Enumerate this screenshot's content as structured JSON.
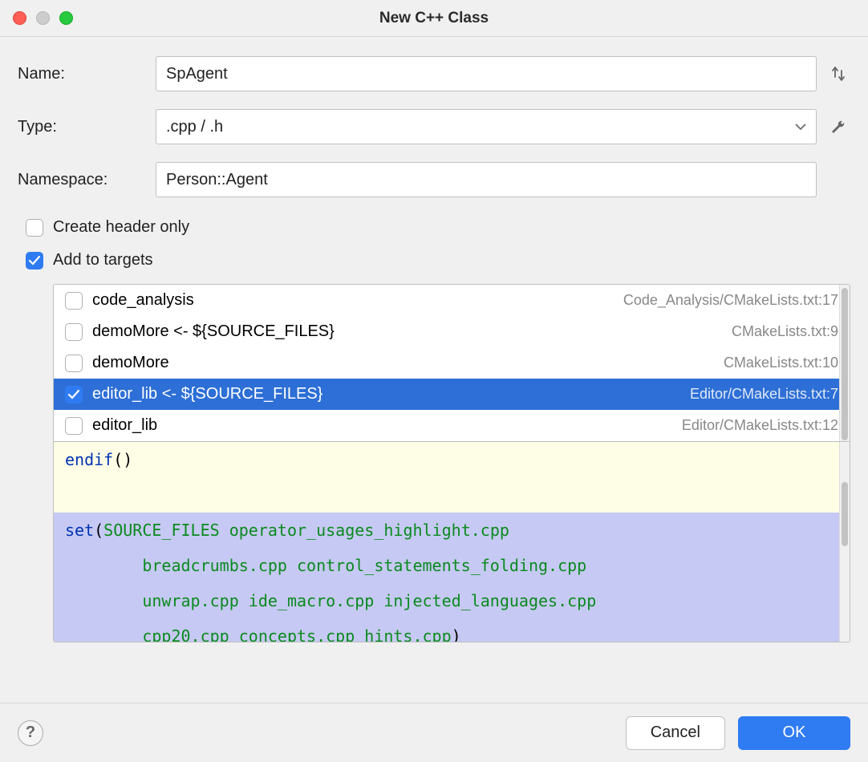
{
  "title": "New C++ Class",
  "form": {
    "name_label": "Name:",
    "name_value": "SpAgent",
    "type_label": "Type:",
    "type_value": ".cpp / .h",
    "namespace_label": "Namespace:",
    "namespace_value": "Person::Agent"
  },
  "checkboxes": {
    "create_header_only": "Create header only",
    "add_to_targets": "Add to targets"
  },
  "targets": [
    {
      "name": "code_analysis",
      "path": "Code_Analysis/CMakeLists.txt:17",
      "checked": false,
      "selected": false
    },
    {
      "name": "demoMore <- ${SOURCE_FILES}",
      "path": "CMakeLists.txt:9",
      "checked": false,
      "selected": false
    },
    {
      "name": "demoMore",
      "path": "CMakeLists.txt:10",
      "checked": false,
      "selected": false
    },
    {
      "name": "editor_lib <- ${SOURCE_FILES}",
      "path": "Editor/CMakeLists.txt:7",
      "checked": true,
      "selected": true
    },
    {
      "name": "editor_lib",
      "path": "Editor/CMakeLists.txt:12",
      "checked": false,
      "selected": false
    }
  ],
  "code": {
    "l1_kw": "endif",
    "l1_paren": "()",
    "l2_kw": "set",
    "l2_open": "(",
    "l2_var": "SOURCE_FILES",
    "l2_f1": " operator_usages_highlight.cpp",
    "l3": "        breadcrumbs.cpp control_statements_folding.cpp",
    "l4": "        unwrap.cpp ide_macro.cpp injected_languages.cpp",
    "l5_files": "        cpp20.cpp concepts.cpp hints.cpp",
    "l5_close": ")"
  },
  "footer": {
    "cancel": "Cancel",
    "ok": "OK"
  }
}
